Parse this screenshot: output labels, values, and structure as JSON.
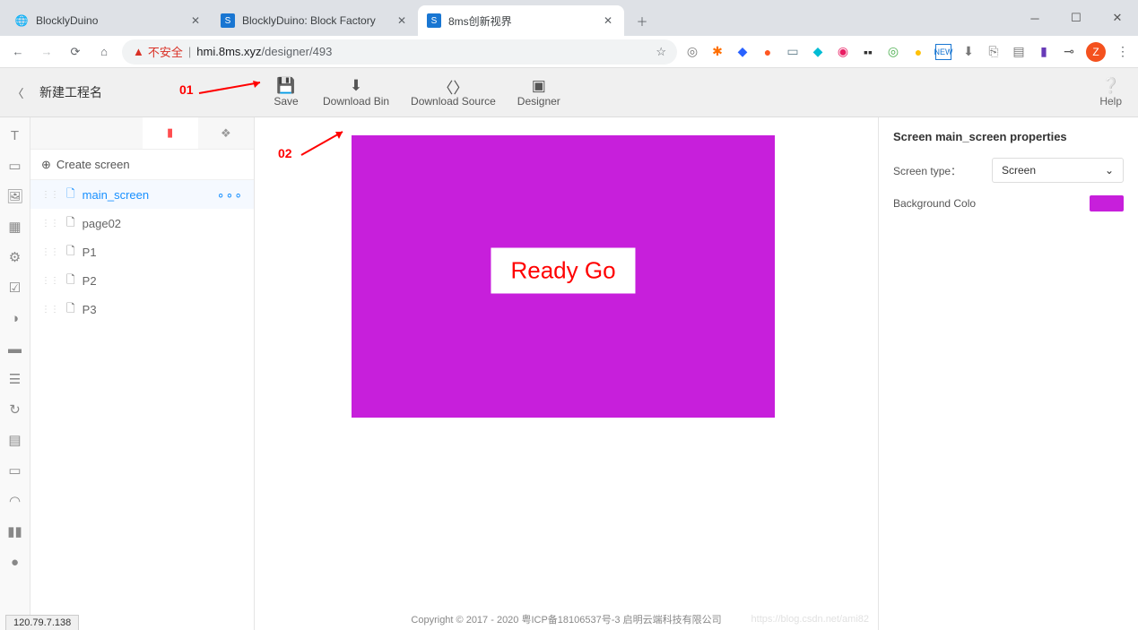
{
  "browser": {
    "tabs": [
      {
        "title": "BlocklyDuino",
        "active": false
      },
      {
        "title": "BlocklyDuino: Block Factory",
        "active": false
      },
      {
        "title": "8ms创新视界",
        "active": true
      }
    ],
    "security_label": "不安全",
    "url_host": "hmi.8ms.xyz",
    "url_path": "/designer/493",
    "avatar_letter": "Z"
  },
  "toolbar": {
    "project_name": "新建工程名",
    "save": "Save",
    "download_bin": "Download Bin",
    "download_source": "Download Source",
    "designer": "Designer",
    "help": "Help"
  },
  "annotations": {
    "a01": "01",
    "a02": "02"
  },
  "panel": {
    "create_screen": "Create screen",
    "screens": [
      {
        "name": "main_screen",
        "active": true
      },
      {
        "name": "page02",
        "active": false
      },
      {
        "name": "P1",
        "active": false
      },
      {
        "name": "P2",
        "active": false
      },
      {
        "name": "P3",
        "active": false
      }
    ]
  },
  "canvas": {
    "label_text": "Ready Go",
    "bg_color": "#c71fdb"
  },
  "props": {
    "title": "Screen main_screen properties",
    "screen_type_label": "Screen type：",
    "screen_type_value": "Screen",
    "bg_label": "Background Colo"
  },
  "footer": "Copyright © 2017 - 2020 粤ICP备18106537号-3 启明云端科技有限公司",
  "watermark": "https://blog.csdn.net/ami82",
  "status_ip": "120.79.7.138"
}
